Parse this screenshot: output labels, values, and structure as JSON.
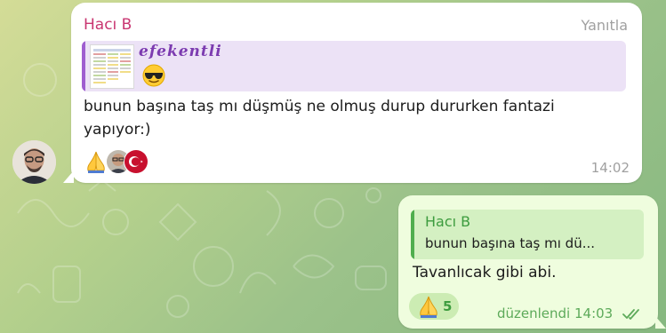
{
  "incoming": {
    "sender": "Hacı B",
    "reply_label": "Yanıtla",
    "quote": {
      "name": "efekentli",
      "emoji": "😎"
    },
    "text": "bunun başına taş mı düşmüş ne olmuş durup dururken fantazi yapıyor:)",
    "reaction_emoji": "🙏",
    "time": "14:02"
  },
  "outgoing": {
    "quote": {
      "name": "Hacı B",
      "text": "bunun başına taş mı dü..."
    },
    "text": "Tavanlıcak gibi abi.",
    "reaction": {
      "emoji": "🙏",
      "count": "5"
    },
    "meta": "düzenlendi 14:03",
    "status_icon": "double-check-icon"
  },
  "colors": {
    "incoming_sender": "#c93671",
    "quote_accent": "#9f5ed0",
    "outgoing_bubble": "#effdde",
    "outgoing_accent": "#3d9c3f"
  }
}
